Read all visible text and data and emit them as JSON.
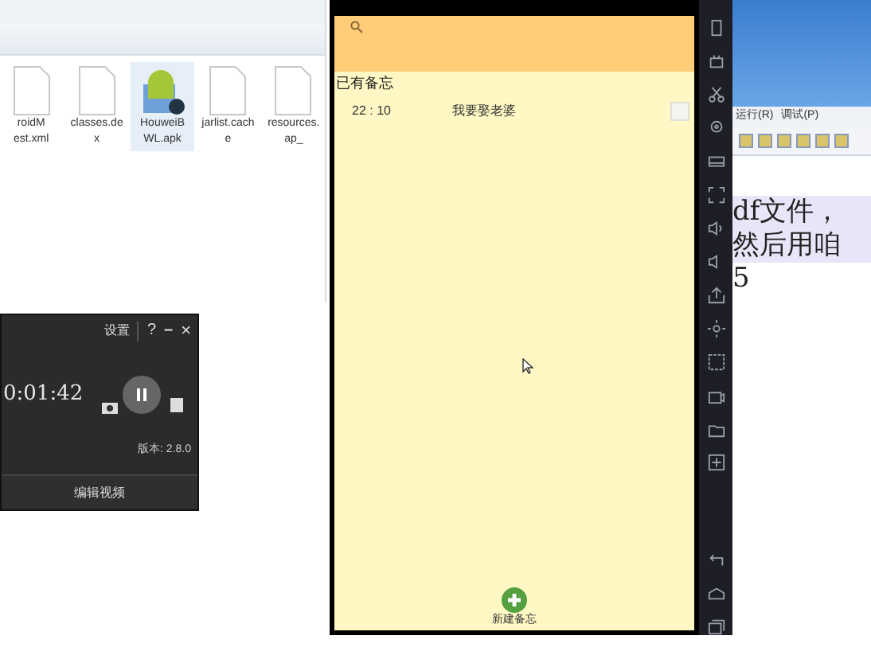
{
  "explorer": {
    "files": [
      {
        "label_lines": [
          "roidM",
          "est.xml"
        ],
        "selected": false
      },
      {
        "label_lines": [
          "classes.de",
          "x"
        ],
        "selected": false
      },
      {
        "label_lines": [
          "HouweiB",
          "WL.apk"
        ],
        "selected": true
      },
      {
        "label_lines": [
          "jarlist.cach",
          "e"
        ],
        "selected": false
      },
      {
        "label_lines": [
          "resources.",
          "ap_"
        ],
        "selected": false
      }
    ]
  },
  "recorder": {
    "settings": "设置",
    "help": "?",
    "minimize": "–",
    "close": "×",
    "time": "0:01:42",
    "version": "版本: 2.8.0",
    "edit_button": "编辑视频"
  },
  "emulator": {
    "section_title": "已有备忘",
    "memos": [
      {
        "time": "22 : 10",
        "text": "我要娶老婆"
      }
    ],
    "new_button": "新建备忘"
  },
  "editor": {
    "menu": [
      "运行(R)",
      "调试(P)"
    ],
    "lines": [
      "df文件，",
      "然后用咱",
      "5"
    ]
  }
}
